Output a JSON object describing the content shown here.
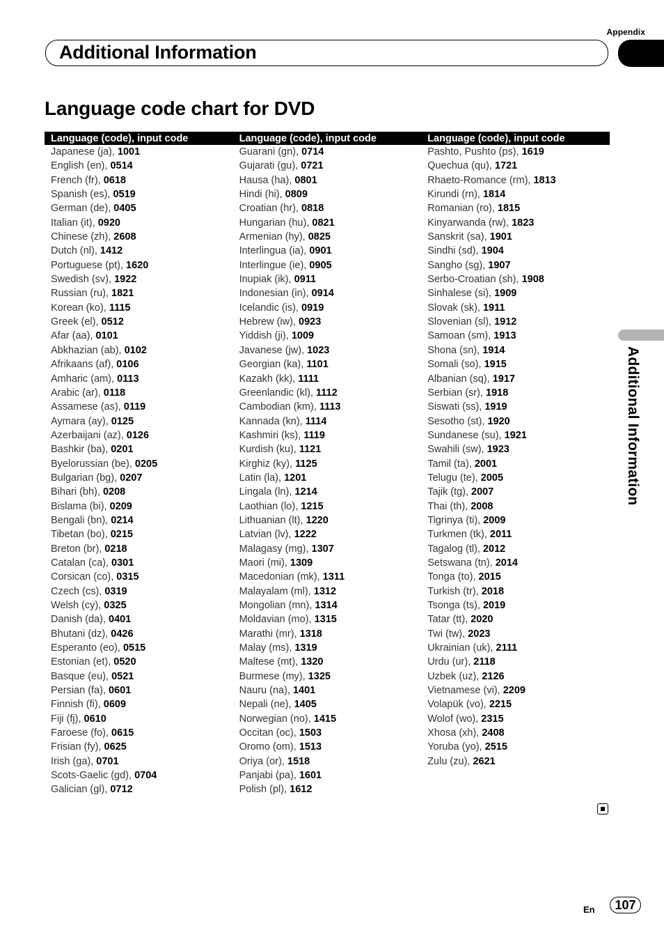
{
  "header": {
    "appendix_label": "Appendix",
    "section_title": "Additional Information"
  },
  "page_title": "Language code chart for DVD",
  "table": {
    "columns": [
      {
        "header": "Language (code), input code",
        "rows": [
          {
            "language": "Japanese (ja), ",
            "code": "1001"
          },
          {
            "language": "English (en), ",
            "code": "0514"
          },
          {
            "language": "French (fr), ",
            "code": "0618"
          },
          {
            "language": "Spanish (es), ",
            "code": "0519"
          },
          {
            "language": "German (de), ",
            "code": "0405"
          },
          {
            "language": "Italian (it), ",
            "code": "0920"
          },
          {
            "language": "Chinese (zh), ",
            "code": "2608"
          },
          {
            "language": "Dutch (nl), ",
            "code": "1412"
          },
          {
            "language": "Portuguese (pt), ",
            "code": "1620"
          },
          {
            "language": "Swedish (sv), ",
            "code": "1922"
          },
          {
            "language": "Russian (ru), ",
            "code": "1821"
          },
          {
            "language": "Korean (ko), ",
            "code": "1115"
          },
          {
            "language": "Greek (el), ",
            "code": "0512"
          },
          {
            "language": "Afar (aa), ",
            "code": "0101"
          },
          {
            "language": "Abkhazian (ab), ",
            "code": "0102"
          },
          {
            "language": "Afrikaans (af), ",
            "code": "0106"
          },
          {
            "language": "Amharic (am), ",
            "code": "0113"
          },
          {
            "language": "Arabic (ar), ",
            "code": "0118"
          },
          {
            "language": "Assamese (as), ",
            "code": "0119"
          },
          {
            "language": "Aymara (ay), ",
            "code": "0125"
          },
          {
            "language": "Azerbaijani (az), ",
            "code": "0126"
          },
          {
            "language": "Bashkir (ba), ",
            "code": "0201"
          },
          {
            "language": "Byelorussian (be), ",
            "code": "0205"
          },
          {
            "language": "Bulgarian (bg), ",
            "code": "0207"
          },
          {
            "language": "Bihari (bh), ",
            "code": "0208"
          },
          {
            "language": "Bislama (bi), ",
            "code": "0209"
          },
          {
            "language": "Bengali (bn), ",
            "code": "0214"
          },
          {
            "language": "Tibetan (bo), ",
            "code": "0215"
          },
          {
            "language": "Breton (br), ",
            "code": "0218"
          },
          {
            "language": "Catalan (ca), ",
            "code": "0301"
          },
          {
            "language": "Corsican (co), ",
            "code": "0315"
          },
          {
            "language": "Czech (cs), ",
            "code": "0319"
          },
          {
            "language": "Welsh (cy), ",
            "code": "0325"
          },
          {
            "language": "Danish (da), ",
            "code": "0401"
          },
          {
            "language": "Bhutani (dz), ",
            "code": "0426"
          },
          {
            "language": "Esperanto (eo), ",
            "code": "0515"
          },
          {
            "language": "Estonian (et), ",
            "code": "0520"
          },
          {
            "language": "Basque (eu), ",
            "code": "0521"
          },
          {
            "language": "Persian (fa), ",
            "code": "0601"
          },
          {
            "language": "Finnish (fi), ",
            "code": "0609"
          },
          {
            "language": "Fiji (fj), ",
            "code": "0610"
          },
          {
            "language": "Faroese (fo), ",
            "code": "0615"
          },
          {
            "language": "Frisian (fy), ",
            "code": "0625"
          },
          {
            "language": "Irish (ga), ",
            "code": "0701"
          },
          {
            "language": "Scots-Gaelic (gd), ",
            "code": "0704"
          },
          {
            "language": "Galician (gl), ",
            "code": "0712"
          }
        ]
      },
      {
        "header": "Language (code), input code",
        "rows": [
          {
            "language": "Guarani (gn), ",
            "code": "0714"
          },
          {
            "language": "Gujarati (gu), ",
            "code": "0721"
          },
          {
            "language": "Hausa (ha), ",
            "code": "0801"
          },
          {
            "language": "Hindi (hi), ",
            "code": "0809"
          },
          {
            "language": "Croatian (hr), ",
            "code": "0818"
          },
          {
            "language": "Hungarian (hu), ",
            "code": "0821"
          },
          {
            "language": "Armenian (hy), ",
            "code": "0825"
          },
          {
            "language": "Interlingua (ia), ",
            "code": "0901"
          },
          {
            "language": "Interlingue (ie), ",
            "code": "0905"
          },
          {
            "language": "Inupiak (ik), ",
            "code": "0911"
          },
          {
            "language": "Indonesian (in), ",
            "code": "0914"
          },
          {
            "language": "Icelandic (is), ",
            "code": "0919"
          },
          {
            "language": "Hebrew (iw), ",
            "code": "0923"
          },
          {
            "language": "Yiddish (ji), ",
            "code": "1009"
          },
          {
            "language": "Javanese (jw), ",
            "code": "1023"
          },
          {
            "language": "Georgian (ka), ",
            "code": "1101"
          },
          {
            "language": "Kazakh (kk), ",
            "code": "1111"
          },
          {
            "language": "Greenlandic (kl), ",
            "code": "1112"
          },
          {
            "language": "Cambodian (km), ",
            "code": "1113"
          },
          {
            "language": "Kannada (kn), ",
            "code": "1114"
          },
          {
            "language": "Kashmiri (ks), ",
            "code": "1119"
          },
          {
            "language": "Kurdish (ku), ",
            "code": "1121"
          },
          {
            "language": "Kirghiz (ky), ",
            "code": "1125"
          },
          {
            "language": "Latin (la), ",
            "code": "1201"
          },
          {
            "language": "Lingala (ln), ",
            "code": "1214"
          },
          {
            "language": "Laothian (lo), ",
            "code": "1215"
          },
          {
            "language": "Lithuanian (lt), ",
            "code": "1220"
          },
          {
            "language": "Latvian (lv), ",
            "code": "1222"
          },
          {
            "language": "Malagasy (mg), ",
            "code": "1307"
          },
          {
            "language": "Maori (mi), ",
            "code": "1309"
          },
          {
            "language": "Macedonian (mk), ",
            "code": "1311"
          },
          {
            "language": "Malayalam (ml), ",
            "code": "1312"
          },
          {
            "language": "Mongolian (mn), ",
            "code": "1314"
          },
          {
            "language": "Moldavian (mo), ",
            "code": "1315"
          },
          {
            "language": "Marathi (mr), ",
            "code": "1318"
          },
          {
            "language": "Malay (ms), ",
            "code": "1319"
          },
          {
            "language": "Maltese (mt), ",
            "code": "1320"
          },
          {
            "language": "Burmese (my), ",
            "code": "1325"
          },
          {
            "language": "Nauru (na), ",
            "code": "1401"
          },
          {
            "language": "Nepali (ne), ",
            "code": "1405"
          },
          {
            "language": "Norwegian (no), ",
            "code": "1415"
          },
          {
            "language": "Occitan (oc), ",
            "code": "1503"
          },
          {
            "language": "Oromo (om), ",
            "code": "1513"
          },
          {
            "language": "Oriya (or), ",
            "code": "1518"
          },
          {
            "language": "Panjabi (pa), ",
            "code": "1601"
          },
          {
            "language": "Polish (pl), ",
            "code": "1612"
          }
        ]
      },
      {
        "header": "Language (code), input code",
        "rows": [
          {
            "language": "Pashto, Pushto (ps), ",
            "code": "1619"
          },
          {
            "language": "Quechua (qu), ",
            "code": "1721"
          },
          {
            "language": "Rhaeto-Romance (rm), ",
            "code": "1813"
          },
          {
            "language": "Kirundi (rn), ",
            "code": "1814"
          },
          {
            "language": "Romanian (ro), ",
            "code": "1815"
          },
          {
            "language": "Kinyarwanda (rw), ",
            "code": "1823"
          },
          {
            "language": "Sanskrit (sa), ",
            "code": "1901"
          },
          {
            "language": "Sindhi (sd), ",
            "code": "1904"
          },
          {
            "language": "Sangho (sg), ",
            "code": "1907"
          },
          {
            "language": "Serbo-Croatian (sh), ",
            "code": "1908"
          },
          {
            "language": "Sinhalese (si), ",
            "code": "1909"
          },
          {
            "language": "Slovak (sk), ",
            "code": "1911"
          },
          {
            "language": "Slovenian (sl), ",
            "code": "1912"
          },
          {
            "language": "Samoan (sm), ",
            "code": "1913"
          },
          {
            "language": "Shona (sn), ",
            "code": "1914"
          },
          {
            "language": "Somali (so), ",
            "code": "1915"
          },
          {
            "language": "Albanian (sq), ",
            "code": "1917"
          },
          {
            "language": "Serbian (sr), ",
            "code": "1918"
          },
          {
            "language": "Siswati (ss), ",
            "code": "1919"
          },
          {
            "language": "Sesotho (st), ",
            "code": "1920"
          },
          {
            "language": "Sundanese (su), ",
            "code": "1921"
          },
          {
            "language": "Swahili (sw), ",
            "code": "1923"
          },
          {
            "language": "Tamil (ta), ",
            "code": "2001"
          },
          {
            "language": "Telugu (te), ",
            "code": "2005"
          },
          {
            "language": "Tajik (tg), ",
            "code": "2007"
          },
          {
            "language": "Thai (th), ",
            "code": "2008"
          },
          {
            "language": "Tigrinya (ti), ",
            "code": "2009"
          },
          {
            "language": "Turkmen (tk), ",
            "code": "2011"
          },
          {
            "language": "Tagalog (tl), ",
            "code": "2012"
          },
          {
            "language": "Setswana (tn), ",
            "code": "2014"
          },
          {
            "language": "Tonga (to), ",
            "code": "2015"
          },
          {
            "language": "Turkish (tr), ",
            "code": "2018"
          },
          {
            "language": "Tsonga (ts), ",
            "code": "2019"
          },
          {
            "language": "Tatar (tt), ",
            "code": "2020"
          },
          {
            "language": "Twi (tw), ",
            "code": "2023"
          },
          {
            "language": "Ukrainian (uk), ",
            "code": "2111"
          },
          {
            "language": "Urdu (ur), ",
            "code": "2118"
          },
          {
            "language": "Uzbek (uz), ",
            "code": "2126"
          },
          {
            "language": "Vietnamese (vi), ",
            "code": "2209"
          },
          {
            "language": "Volapük (vo), ",
            "code": "2215"
          },
          {
            "language": "Wolof (wo), ",
            "code": "2315"
          },
          {
            "language": "Xhosa (xh), ",
            "code": "2408"
          },
          {
            "language": "Yoruba (yo), ",
            "code": "2515"
          },
          {
            "language": "Zulu (zu), ",
            "code": "2621"
          }
        ]
      }
    ]
  },
  "side_tab": {
    "label": "Additional Information"
  },
  "footer": {
    "end_mark_icon": "end-of-section-square-icon",
    "language_label": "En",
    "page_number": "107"
  }
}
